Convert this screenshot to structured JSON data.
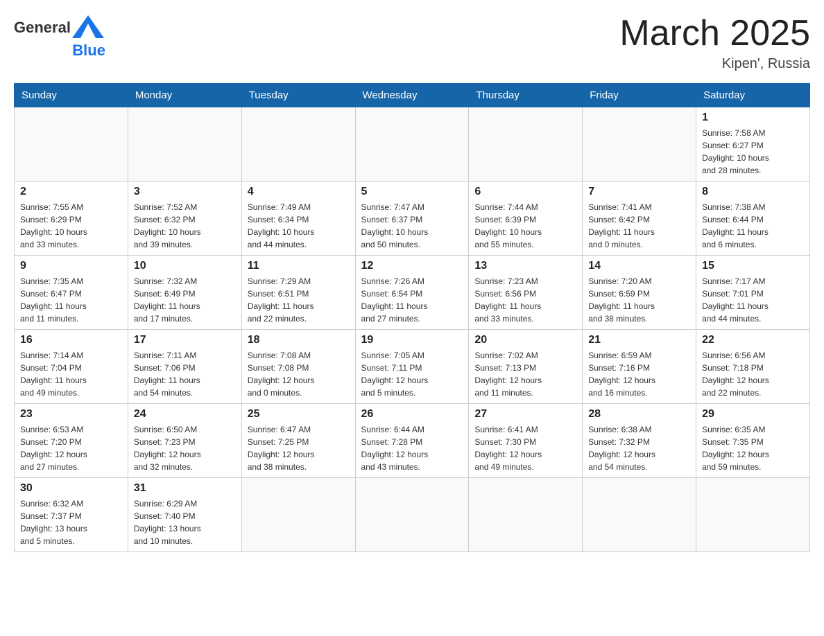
{
  "header": {
    "logo_general": "General",
    "logo_blue": "Blue",
    "month_title": "March 2025",
    "location": "Kipen', Russia"
  },
  "weekdays": [
    "Sunday",
    "Monday",
    "Tuesday",
    "Wednesday",
    "Thursday",
    "Friday",
    "Saturday"
  ],
  "weeks": [
    [
      {
        "day": "",
        "info": ""
      },
      {
        "day": "",
        "info": ""
      },
      {
        "day": "",
        "info": ""
      },
      {
        "day": "",
        "info": ""
      },
      {
        "day": "",
        "info": ""
      },
      {
        "day": "",
        "info": ""
      },
      {
        "day": "1",
        "info": "Sunrise: 7:58 AM\nSunset: 6:27 PM\nDaylight: 10 hours\nand 28 minutes."
      }
    ],
    [
      {
        "day": "2",
        "info": "Sunrise: 7:55 AM\nSunset: 6:29 PM\nDaylight: 10 hours\nand 33 minutes."
      },
      {
        "day": "3",
        "info": "Sunrise: 7:52 AM\nSunset: 6:32 PM\nDaylight: 10 hours\nand 39 minutes."
      },
      {
        "day": "4",
        "info": "Sunrise: 7:49 AM\nSunset: 6:34 PM\nDaylight: 10 hours\nand 44 minutes."
      },
      {
        "day": "5",
        "info": "Sunrise: 7:47 AM\nSunset: 6:37 PM\nDaylight: 10 hours\nand 50 minutes."
      },
      {
        "day": "6",
        "info": "Sunrise: 7:44 AM\nSunset: 6:39 PM\nDaylight: 10 hours\nand 55 minutes."
      },
      {
        "day": "7",
        "info": "Sunrise: 7:41 AM\nSunset: 6:42 PM\nDaylight: 11 hours\nand 0 minutes."
      },
      {
        "day": "8",
        "info": "Sunrise: 7:38 AM\nSunset: 6:44 PM\nDaylight: 11 hours\nand 6 minutes."
      }
    ],
    [
      {
        "day": "9",
        "info": "Sunrise: 7:35 AM\nSunset: 6:47 PM\nDaylight: 11 hours\nand 11 minutes."
      },
      {
        "day": "10",
        "info": "Sunrise: 7:32 AM\nSunset: 6:49 PM\nDaylight: 11 hours\nand 17 minutes."
      },
      {
        "day": "11",
        "info": "Sunrise: 7:29 AM\nSunset: 6:51 PM\nDaylight: 11 hours\nand 22 minutes."
      },
      {
        "day": "12",
        "info": "Sunrise: 7:26 AM\nSunset: 6:54 PM\nDaylight: 11 hours\nand 27 minutes."
      },
      {
        "day": "13",
        "info": "Sunrise: 7:23 AM\nSunset: 6:56 PM\nDaylight: 11 hours\nand 33 minutes."
      },
      {
        "day": "14",
        "info": "Sunrise: 7:20 AM\nSunset: 6:59 PM\nDaylight: 11 hours\nand 38 minutes."
      },
      {
        "day": "15",
        "info": "Sunrise: 7:17 AM\nSunset: 7:01 PM\nDaylight: 11 hours\nand 44 minutes."
      }
    ],
    [
      {
        "day": "16",
        "info": "Sunrise: 7:14 AM\nSunset: 7:04 PM\nDaylight: 11 hours\nand 49 minutes."
      },
      {
        "day": "17",
        "info": "Sunrise: 7:11 AM\nSunset: 7:06 PM\nDaylight: 11 hours\nand 54 minutes."
      },
      {
        "day": "18",
        "info": "Sunrise: 7:08 AM\nSunset: 7:08 PM\nDaylight: 12 hours\nand 0 minutes."
      },
      {
        "day": "19",
        "info": "Sunrise: 7:05 AM\nSunset: 7:11 PM\nDaylight: 12 hours\nand 5 minutes."
      },
      {
        "day": "20",
        "info": "Sunrise: 7:02 AM\nSunset: 7:13 PM\nDaylight: 12 hours\nand 11 minutes."
      },
      {
        "day": "21",
        "info": "Sunrise: 6:59 AM\nSunset: 7:16 PM\nDaylight: 12 hours\nand 16 minutes."
      },
      {
        "day": "22",
        "info": "Sunrise: 6:56 AM\nSunset: 7:18 PM\nDaylight: 12 hours\nand 22 minutes."
      }
    ],
    [
      {
        "day": "23",
        "info": "Sunrise: 6:53 AM\nSunset: 7:20 PM\nDaylight: 12 hours\nand 27 minutes."
      },
      {
        "day": "24",
        "info": "Sunrise: 6:50 AM\nSunset: 7:23 PM\nDaylight: 12 hours\nand 32 minutes."
      },
      {
        "day": "25",
        "info": "Sunrise: 6:47 AM\nSunset: 7:25 PM\nDaylight: 12 hours\nand 38 minutes."
      },
      {
        "day": "26",
        "info": "Sunrise: 6:44 AM\nSunset: 7:28 PM\nDaylight: 12 hours\nand 43 minutes."
      },
      {
        "day": "27",
        "info": "Sunrise: 6:41 AM\nSunset: 7:30 PM\nDaylight: 12 hours\nand 49 minutes."
      },
      {
        "day": "28",
        "info": "Sunrise: 6:38 AM\nSunset: 7:32 PM\nDaylight: 12 hours\nand 54 minutes."
      },
      {
        "day": "29",
        "info": "Sunrise: 6:35 AM\nSunset: 7:35 PM\nDaylight: 12 hours\nand 59 minutes."
      }
    ],
    [
      {
        "day": "30",
        "info": "Sunrise: 6:32 AM\nSunset: 7:37 PM\nDaylight: 13 hours\nand 5 minutes."
      },
      {
        "day": "31",
        "info": "Sunrise: 6:29 AM\nSunset: 7:40 PM\nDaylight: 13 hours\nand 10 minutes."
      },
      {
        "day": "",
        "info": ""
      },
      {
        "day": "",
        "info": ""
      },
      {
        "day": "",
        "info": ""
      },
      {
        "day": "",
        "info": ""
      },
      {
        "day": "",
        "info": ""
      }
    ]
  ],
  "colors": {
    "header_bg": "#1565a8",
    "header_text": "#ffffff",
    "border": "#cccccc",
    "day_number": "#222222",
    "day_info": "#333333"
  }
}
